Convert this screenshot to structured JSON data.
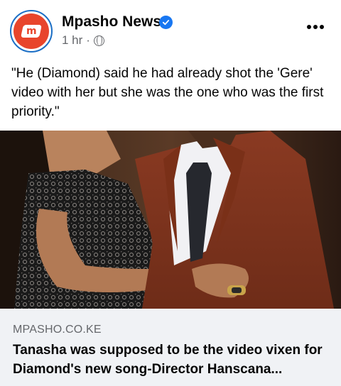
{
  "post": {
    "page_name": "Mpasho News",
    "time": "1 hr",
    "separator": "·",
    "privacy_icon": "globe-icon",
    "verified_icon": "verified-badge-icon",
    "more_icon": "more-options-icon",
    "text": "\"He (Diamond) said he had already shot the 'Gere' video with her but she was the one who was the first priority.\""
  },
  "link": {
    "domain": "MPASHO.CO.KE",
    "title": "Tanasha was supposed to be the video vixen for Diamond's new song-Director Hanscana..."
  },
  "colors": {
    "brand": "#e8452c",
    "verified": "#1877f2",
    "preview_bg": "#f0f2f5",
    "secondary_text": "#65676b"
  }
}
